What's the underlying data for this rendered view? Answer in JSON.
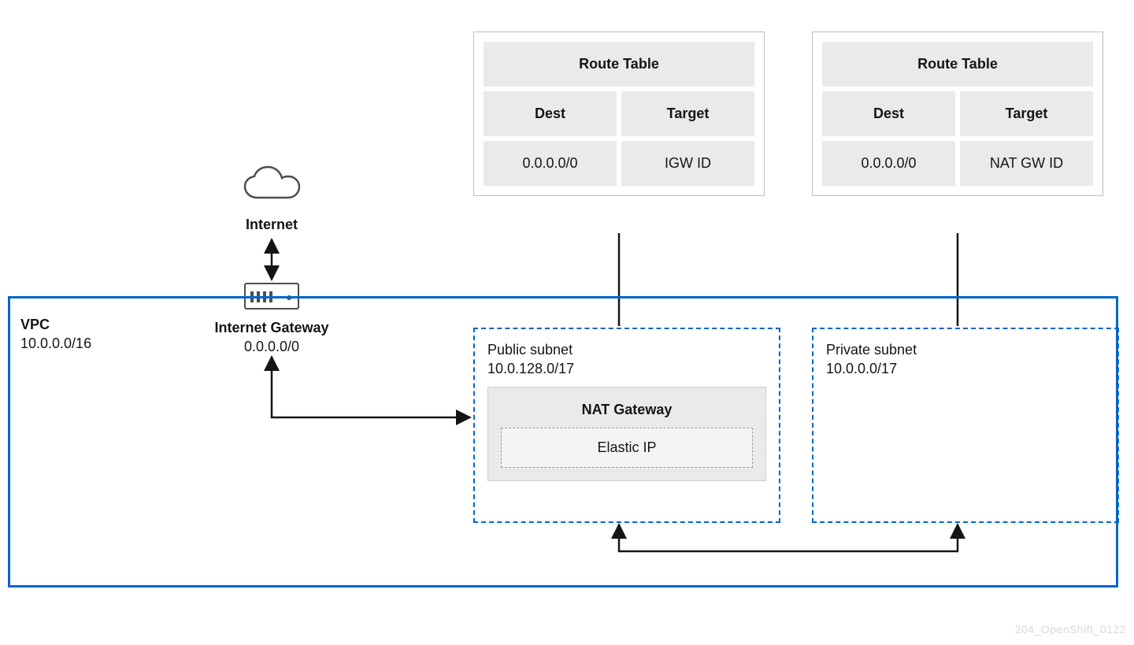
{
  "internet": {
    "label": "Internet"
  },
  "gateway": {
    "title": "Internet Gateway",
    "cidr": "0.0.0.0/0"
  },
  "vpc": {
    "title": "VPC",
    "cidr": "10.0.0.0/16"
  },
  "route_tables": {
    "public": {
      "title": "Route Table",
      "columns": [
        "Dest",
        "Target"
      ],
      "rows": [
        [
          "0.0.0.0/0",
          "IGW ID"
        ]
      ]
    },
    "private": {
      "title": "Route Table",
      "columns": [
        "Dest",
        "Target"
      ],
      "rows": [
        [
          "0.0.0.0/0",
          "NAT GW ID"
        ]
      ]
    }
  },
  "subnets": {
    "public": {
      "title": "Public subnet",
      "cidr": "10.0.128.0/17"
    },
    "private": {
      "title": "Private subnet",
      "cidr": "10.0.0.0/17"
    }
  },
  "nat": {
    "title": "NAT  Gateway",
    "elastic_ip_label": "Elastic IP"
  },
  "watermark": "204_OpenShift_0122"
}
